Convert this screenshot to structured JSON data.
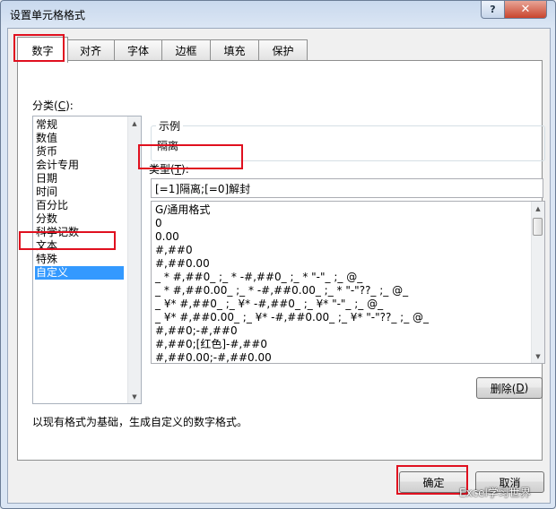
{
  "window": {
    "title": "设置单元格格式"
  },
  "titlebar": {
    "help": "?",
    "close": "✕"
  },
  "tabs": [
    {
      "label": "数字",
      "active": true
    },
    {
      "label": "对齐"
    },
    {
      "label": "字体"
    },
    {
      "label": "边框"
    },
    {
      "label": "填充"
    },
    {
      "label": "保护"
    }
  ],
  "category": {
    "label": "分类(",
    "hotkey": "C",
    "label_end": "):",
    "items": [
      "常规",
      "数值",
      "货币",
      "会计专用",
      "日期",
      "时间",
      "百分比",
      "分数",
      "科学记数",
      "文本",
      "特殊",
      "自定义"
    ],
    "selected": "自定义"
  },
  "sample": {
    "legend": "示例",
    "value": "隔离"
  },
  "type": {
    "label": "类型(",
    "hotkey": "T",
    "label_end": "):",
    "value": "[=1]隔离;[=0]解封",
    "formats": [
      "G/通用格式",
      "0",
      "0.00",
      "#,##0",
      "#,##0.00",
      "_ * #,##0_ ;_ * -#,##0_ ;_ * \"-\"_ ;_ @_",
      "_ * #,##0.00_ ;_ * -#,##0.00_ ;_ * \"-\"??_ ;_ @_",
      "_ ¥* #,##0_ ;_ ¥* -#,##0_ ;_ ¥* \"-\"_ ;_ @_",
      "_ ¥* #,##0.00_ ;_ ¥* -#,##0.00_ ;_ ¥* \"-\"??_ ;_ @_",
      "#,##0;-#,##0",
      "#,##0;[红色]-#,##0",
      "#,##0.00;-#,##0.00"
    ]
  },
  "delete_button": {
    "label": "删除(",
    "hotkey": "D",
    "label_end": ")"
  },
  "description": "以现有格式为基础，生成自定义的数字格式。",
  "ok_button": "确定",
  "cancel_button": "取消",
  "watermark": "Excel学习世界",
  "colors": {
    "highlight": "#e0101f",
    "selection": "#3399ff"
  }
}
